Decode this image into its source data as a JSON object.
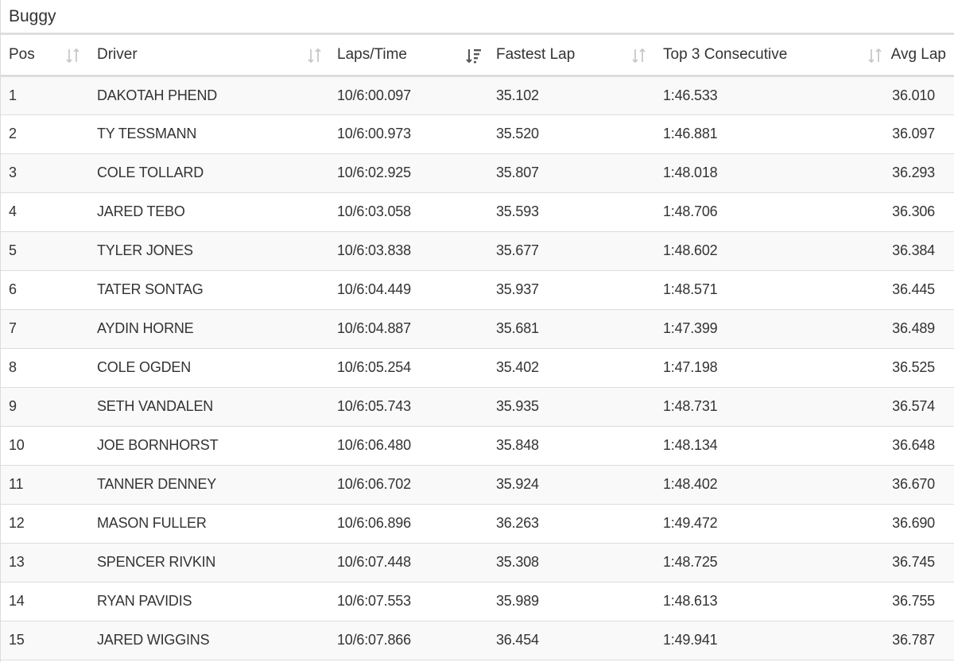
{
  "panel": {
    "title": "Buggy"
  },
  "columns": [
    {
      "key": "pos",
      "label": "Pos",
      "sort_icon": "sort-both-icon"
    },
    {
      "key": "driver",
      "label": "Driver",
      "sort_icon": "sort-both-icon"
    },
    {
      "key": "laps_time",
      "label": "Laps/Time",
      "sort_icon": "sort-descending-icon"
    },
    {
      "key": "fastest_lap",
      "label": "Fastest Lap",
      "sort_icon": "sort-both-icon"
    },
    {
      "key": "top3_consecutive",
      "label": "Top 3 Consecutive",
      "sort_icon": "sort-both-icon"
    },
    {
      "key": "avg_lap",
      "label": "Avg Lap",
      "sort_icon": ""
    }
  ],
  "colors": {
    "sort_icon_inactive": "#c8c8c8",
    "sort_icon_active": "#555555",
    "row_stripe": "#f9f9f9",
    "border": "#dddddd"
  },
  "rows": [
    {
      "pos": "1",
      "driver": "DAKOTAH PHEND",
      "laps_time": "10/6:00.097",
      "fastest_lap": "35.102",
      "top3_consecutive": "1:46.533",
      "avg_lap": "36.010"
    },
    {
      "pos": "2",
      "driver": "TY TESSMANN",
      "laps_time": "10/6:00.973",
      "fastest_lap": "35.520",
      "top3_consecutive": "1:46.881",
      "avg_lap": "36.097"
    },
    {
      "pos": "3",
      "driver": "COLE TOLLARD",
      "laps_time": "10/6:02.925",
      "fastest_lap": "35.807",
      "top3_consecutive": "1:48.018",
      "avg_lap": "36.293"
    },
    {
      "pos": "4",
      "driver": "JARED TEBO",
      "laps_time": "10/6:03.058",
      "fastest_lap": "35.593",
      "top3_consecutive": "1:48.706",
      "avg_lap": "36.306"
    },
    {
      "pos": "5",
      "driver": "TYLER JONES",
      "laps_time": "10/6:03.838",
      "fastest_lap": "35.677",
      "top3_consecutive": "1:48.602",
      "avg_lap": "36.384"
    },
    {
      "pos": "6",
      "driver": "TATER SONTAG",
      "laps_time": "10/6:04.449",
      "fastest_lap": "35.937",
      "top3_consecutive": "1:48.571",
      "avg_lap": "36.445"
    },
    {
      "pos": "7",
      "driver": "AYDIN HORNE",
      "laps_time": "10/6:04.887",
      "fastest_lap": "35.681",
      "top3_consecutive": "1:47.399",
      "avg_lap": "36.489"
    },
    {
      "pos": "8",
      "driver": "COLE OGDEN",
      "laps_time": "10/6:05.254",
      "fastest_lap": "35.402",
      "top3_consecutive": "1:47.198",
      "avg_lap": "36.525"
    },
    {
      "pos": "9",
      "driver": "SETH VANDALEN",
      "laps_time": "10/6:05.743",
      "fastest_lap": "35.935",
      "top3_consecutive": "1:48.731",
      "avg_lap": "36.574"
    },
    {
      "pos": "10",
      "driver": "JOE BORNHORST",
      "laps_time": "10/6:06.480",
      "fastest_lap": "35.848",
      "top3_consecutive": "1:48.134",
      "avg_lap": "36.648"
    },
    {
      "pos": "11",
      "driver": "TANNER DENNEY",
      "laps_time": "10/6:06.702",
      "fastest_lap": "35.924",
      "top3_consecutive": "1:48.402",
      "avg_lap": "36.670"
    },
    {
      "pos": "12",
      "driver": "MASON FULLER",
      "laps_time": "10/6:06.896",
      "fastest_lap": "36.263",
      "top3_consecutive": "1:49.472",
      "avg_lap": "36.690"
    },
    {
      "pos": "13",
      "driver": "SPENCER RIVKIN",
      "laps_time": "10/6:07.448",
      "fastest_lap": "35.308",
      "top3_consecutive": "1:48.725",
      "avg_lap": "36.745"
    },
    {
      "pos": "14",
      "driver": "RYAN PAVIDIS",
      "laps_time": "10/6:07.553",
      "fastest_lap": "35.989",
      "top3_consecutive": "1:48.613",
      "avg_lap": "36.755"
    },
    {
      "pos": "15",
      "driver": "JARED WIGGINS",
      "laps_time": "10/6:07.866",
      "fastest_lap": "36.454",
      "top3_consecutive": "1:49.941",
      "avg_lap": "36.787"
    }
  ]
}
